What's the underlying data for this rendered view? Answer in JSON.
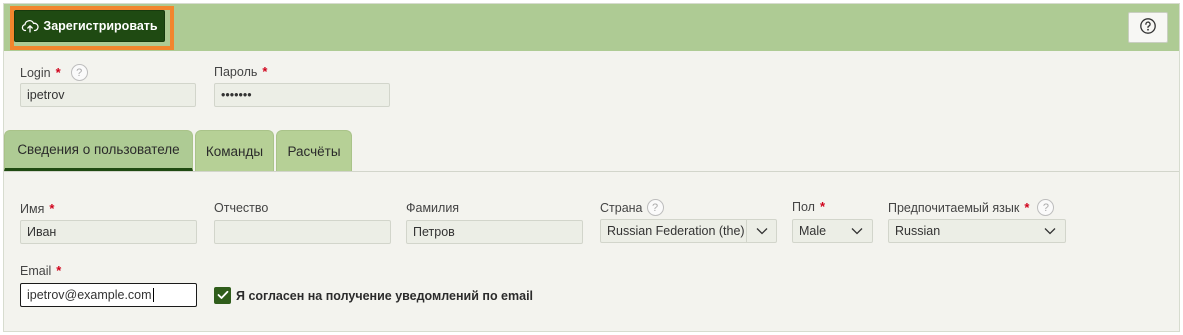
{
  "toolbar": {
    "register_label": "Зарегистрировать",
    "register_icon": "cloud-upload-icon",
    "help_icon": "question-circle-icon",
    "accent_color": "#1f4a12",
    "highlight_color": "#f2862d"
  },
  "account": {
    "login_label": "Login",
    "login_value": "ipetrov",
    "password_label": "Пароль",
    "password_value": "•••••••"
  },
  "tabs": [
    {
      "label": "Сведения о пользователе",
      "active": true
    },
    {
      "label": "Команды",
      "active": false
    },
    {
      "label": "Расчёты",
      "active": false
    }
  ],
  "form": {
    "first_name_label": "Имя",
    "first_name_value": "Иван",
    "middle_name_label": "Отчество",
    "middle_name_value": "",
    "last_name_label": "Фамилия",
    "last_name_value": "Петров",
    "country_label": "Страна",
    "country_value": "Russian Federation (the)",
    "gender_label": "Пол",
    "gender_value": "Male",
    "language_label": "Предпочитаемый язык",
    "language_value": "Russian",
    "email_label": "Email",
    "email_value": "ipetrov@example.com",
    "consent_label": "Я согласен на получение уведомлений по email",
    "consent_checked": true
  },
  "required_marker": "*",
  "help_marker": "?"
}
